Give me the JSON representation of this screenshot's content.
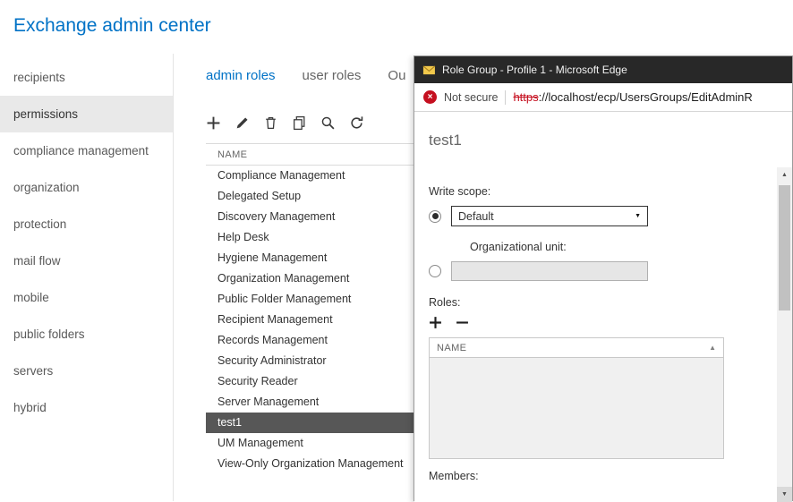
{
  "header": {
    "title": "Exchange admin center"
  },
  "colors": {
    "accent_blue": "#0072C6",
    "selected_row_bg": "#575757",
    "sidebar_selected_bg": "#E9E9E9",
    "titlebar_bg": "#282828",
    "not_secure_red": "#C50F1F"
  },
  "sidebar": {
    "items": [
      {
        "label": "recipients",
        "selected": false
      },
      {
        "label": "permissions",
        "selected": true
      },
      {
        "label": "compliance management",
        "selected": false
      },
      {
        "label": "organization",
        "selected": false
      },
      {
        "label": "protection",
        "selected": false
      },
      {
        "label": "mail flow",
        "selected": false
      },
      {
        "label": "mobile",
        "selected": false
      },
      {
        "label": "public folders",
        "selected": false
      },
      {
        "label": "servers",
        "selected": false
      },
      {
        "label": "hybrid",
        "selected": false
      }
    ]
  },
  "main": {
    "tabs": [
      {
        "label": "admin roles",
        "selected": true
      },
      {
        "label": "user roles",
        "selected": false
      },
      {
        "label": "Ou",
        "selected": false
      }
    ],
    "toolbar_icons": [
      "add-icon",
      "edit-icon",
      "delete-icon",
      "copy-icon",
      "search-icon",
      "refresh-icon"
    ],
    "table": {
      "header": "NAME",
      "selected_row": "test1",
      "rows": [
        "Compliance Management",
        "Delegated Setup",
        "Discovery Management",
        "Help Desk",
        "Hygiene Management",
        "Organization Management",
        "Public Folder Management",
        "Recipient Management",
        "Records Management",
        "Security Administrator",
        "Security Reader",
        "Server Management",
        "test1",
        "UM Management",
        "View-Only Organization Management"
      ]
    }
  },
  "popup": {
    "window_title": "Role Group - Profile 1 - Microsoft Edge",
    "address": {
      "security_label": "Not secure",
      "url_scheme": "https",
      "url_rest": "://localhost/ecp/UsersGroups/EditAdminR"
    },
    "form": {
      "role_group_name": "test1",
      "write_scope_label": "Write scope:",
      "write_scope_selected": "Default",
      "org_unit_label": "Organizational unit:",
      "org_unit_value": "",
      "roles_label": "Roles:",
      "roles_table_header": "NAME",
      "members_label": "Members:"
    }
  }
}
